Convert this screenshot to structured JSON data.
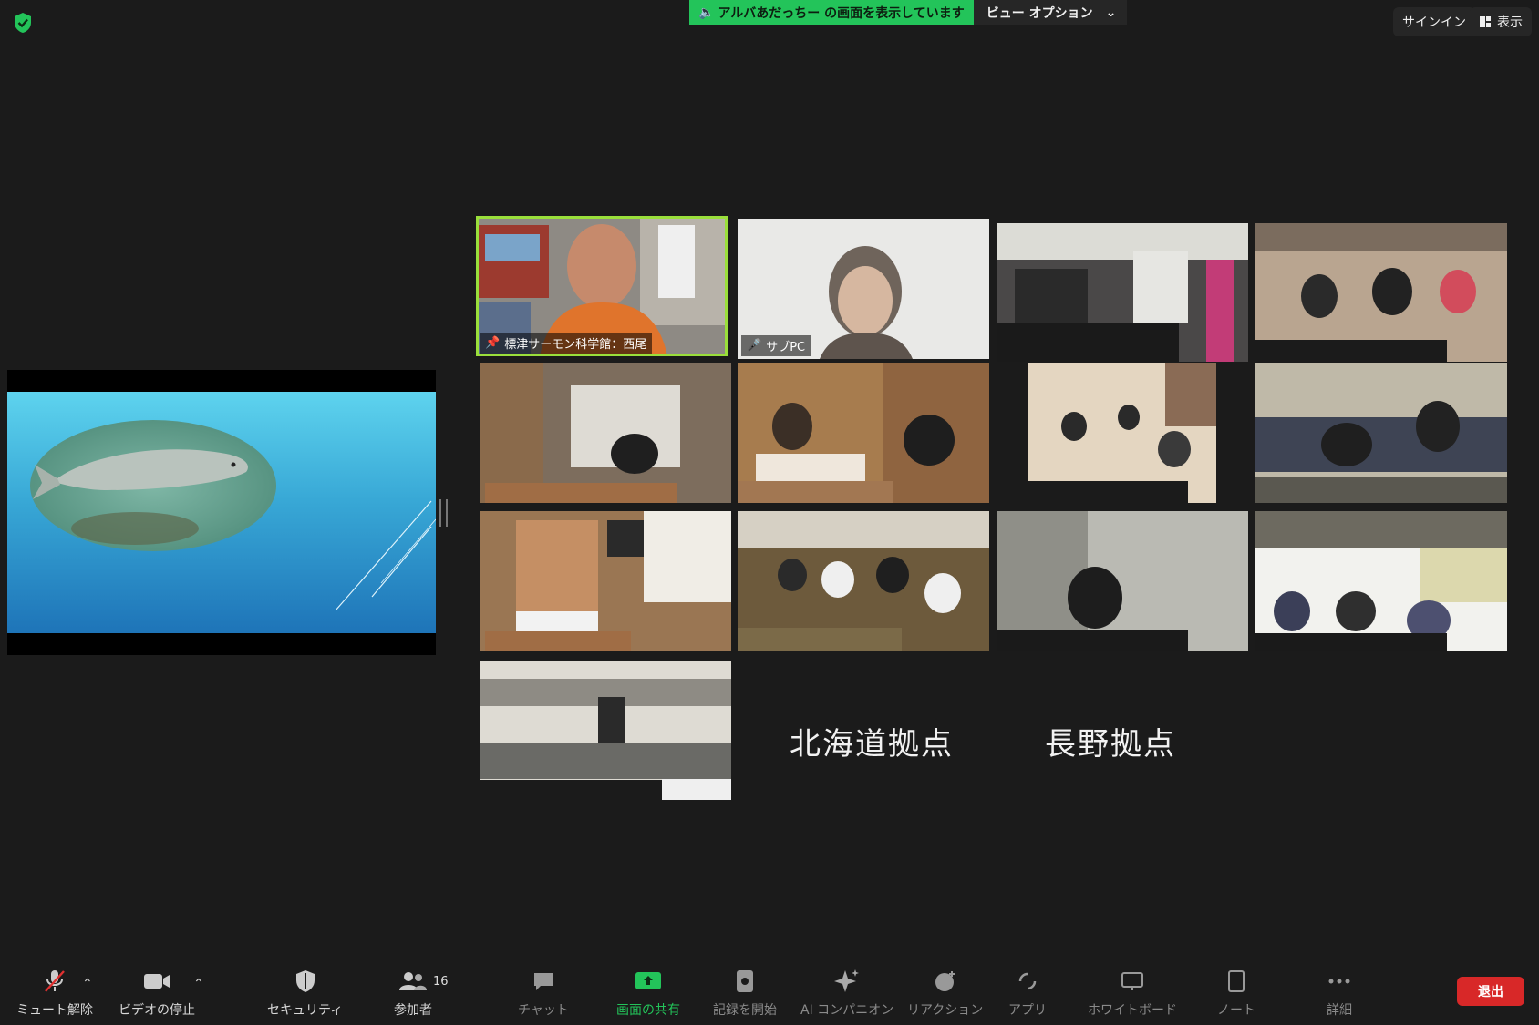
{
  "share_banner": {
    "text": "アルバあだっちー の画面を表示しています",
    "view_options": "ビュー オプション"
  },
  "top_right": {
    "signin": "サインイン",
    "view": "表示"
  },
  "tiles": [
    {
      "name": "標津サーモン科学館：西尾",
      "pinned": true
    },
    {
      "name": "サブPC",
      "muted": true
    }
  ],
  "labels": {
    "hokkaido": "北海道拠点",
    "nagano": "長野拠点"
  },
  "toolbar": {
    "mute": "ミュート解除",
    "video": "ビデオの停止",
    "security": "セキュリティ",
    "participants": "参加者",
    "participants_count": "16",
    "chat": "チャット",
    "share": "画面の共有",
    "record": "記録を開始",
    "ai": "AI コンパニオン",
    "reactions": "リアクション",
    "apps": "アプリ",
    "whiteboard": "ホワイトボード",
    "notes": "ノート",
    "more": "詳細",
    "end": "退出"
  },
  "colors": {
    "accent_green": "#23c45a",
    "active_speaker": "#9adf3b",
    "end_red": "#d82828"
  }
}
